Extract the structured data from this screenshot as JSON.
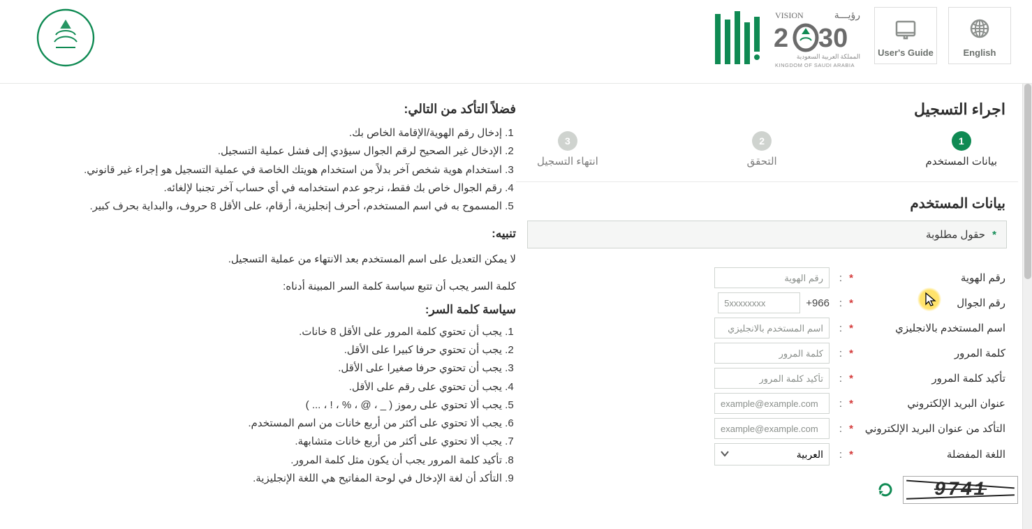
{
  "header": {
    "english_label": "English",
    "guide_label": "User's Guide",
    "vision_top": "VISION رؤيـــة",
    "vision_year": "2030",
    "vision_sub_ar": "المملكة العربية السعودية",
    "vision_sub_en": "KINGDOM OF SAUDI ARABIA"
  },
  "right": {
    "title": "اجراء التسجيل",
    "steps": [
      {
        "num": "1",
        "label": "بيانات المستخدم"
      },
      {
        "num": "2",
        "label": "التحقق"
      },
      {
        "num": "3",
        "label": "انتهاء التسجيل"
      }
    ],
    "sub_title": "بيانات المستخدم",
    "required_note": "حقول مطلوبة",
    "fields": {
      "id": {
        "label": "رقم الهوية",
        "placeholder": "رقم الهوية"
      },
      "mobile": {
        "label": "رقم الجوال",
        "placeholder": "5xxxxxxxx",
        "dial": "+966"
      },
      "username": {
        "label": "اسم المستخدم بالانجليزي",
        "placeholder": "اسم المستخدم بالانجليزي"
      },
      "password": {
        "label": "كلمة المرور",
        "placeholder": "كلمة المرور"
      },
      "password2": {
        "label": "تأكيد كلمة المرور",
        "placeholder": "تأكيد كلمة المرور"
      },
      "email": {
        "label": "عنوان البريد الإلكتروني",
        "placeholder": "example@example.com"
      },
      "email2": {
        "label": "التأكد من عنوان البريد الإلكتروني",
        "placeholder": "example@example.com"
      },
      "lang": {
        "label": "اللغة المفضلة",
        "value": "العربية"
      }
    },
    "captcha": "9741"
  },
  "left": {
    "ensure_title": "فضلاً التأكد من التالي:",
    "ensure_items": [
      "إدخال رقم الهوية/الإقامة الخاص بك.",
      "الإدخال غير الصحيح لرقم الجوال سيؤدي إلى فشل عملية التسجيل.",
      "استخدام هوية شخص آخر بدلاً من استخدام هويتك الخاصة في عملية التسجيل هو إجراء غير قانوني.",
      "رقم الجوال خاص بك فقط، نرجو عدم استخدامه في أي حساب آخر تجنبا لإلغائه.",
      "المسموح به في اسم المستخدم، أحرف إنجليزية، أرقام، على الأقل 8 حروف، والبداية بحرف كبير."
    ],
    "warn_title": "تنبيه:",
    "warn_lines": [
      "لا يمكن التعديل على اسم المستخدم بعد الانتهاء من عملية التسجيل.",
      "كلمة السر يجب أن تتبع سياسة كلمة السر المبينة أدناه:"
    ],
    "password_title": "سياسة كلمة السر:",
    "password_items": [
      "يجب أن تحتوي كلمة المرور على الأقل 8 خانات.",
      "يجب أن تحتوي حرفا كبيرا على الأقل.",
      "يجب أن تحتوي حرفا صغيرا على الأقل.",
      "يجب أن تحتوي على رقم على الأقل.",
      "يجب ألا تحتوي على رموز ( _ ، @ ، % ، ! ، ... )",
      "يجب ألا تحتوي على أكثر من أربع خانات من اسم المستخدم.",
      "يجب ألا تحتوي على أكثر من أربع خانات متشابهة.",
      "تأكيد كلمة المرور يجب أن يكون مثل كلمة المرور.",
      "التأكد أن لغة الإدخال في لوحة المفاتيح هي اللغة الإنجليزية."
    ]
  }
}
